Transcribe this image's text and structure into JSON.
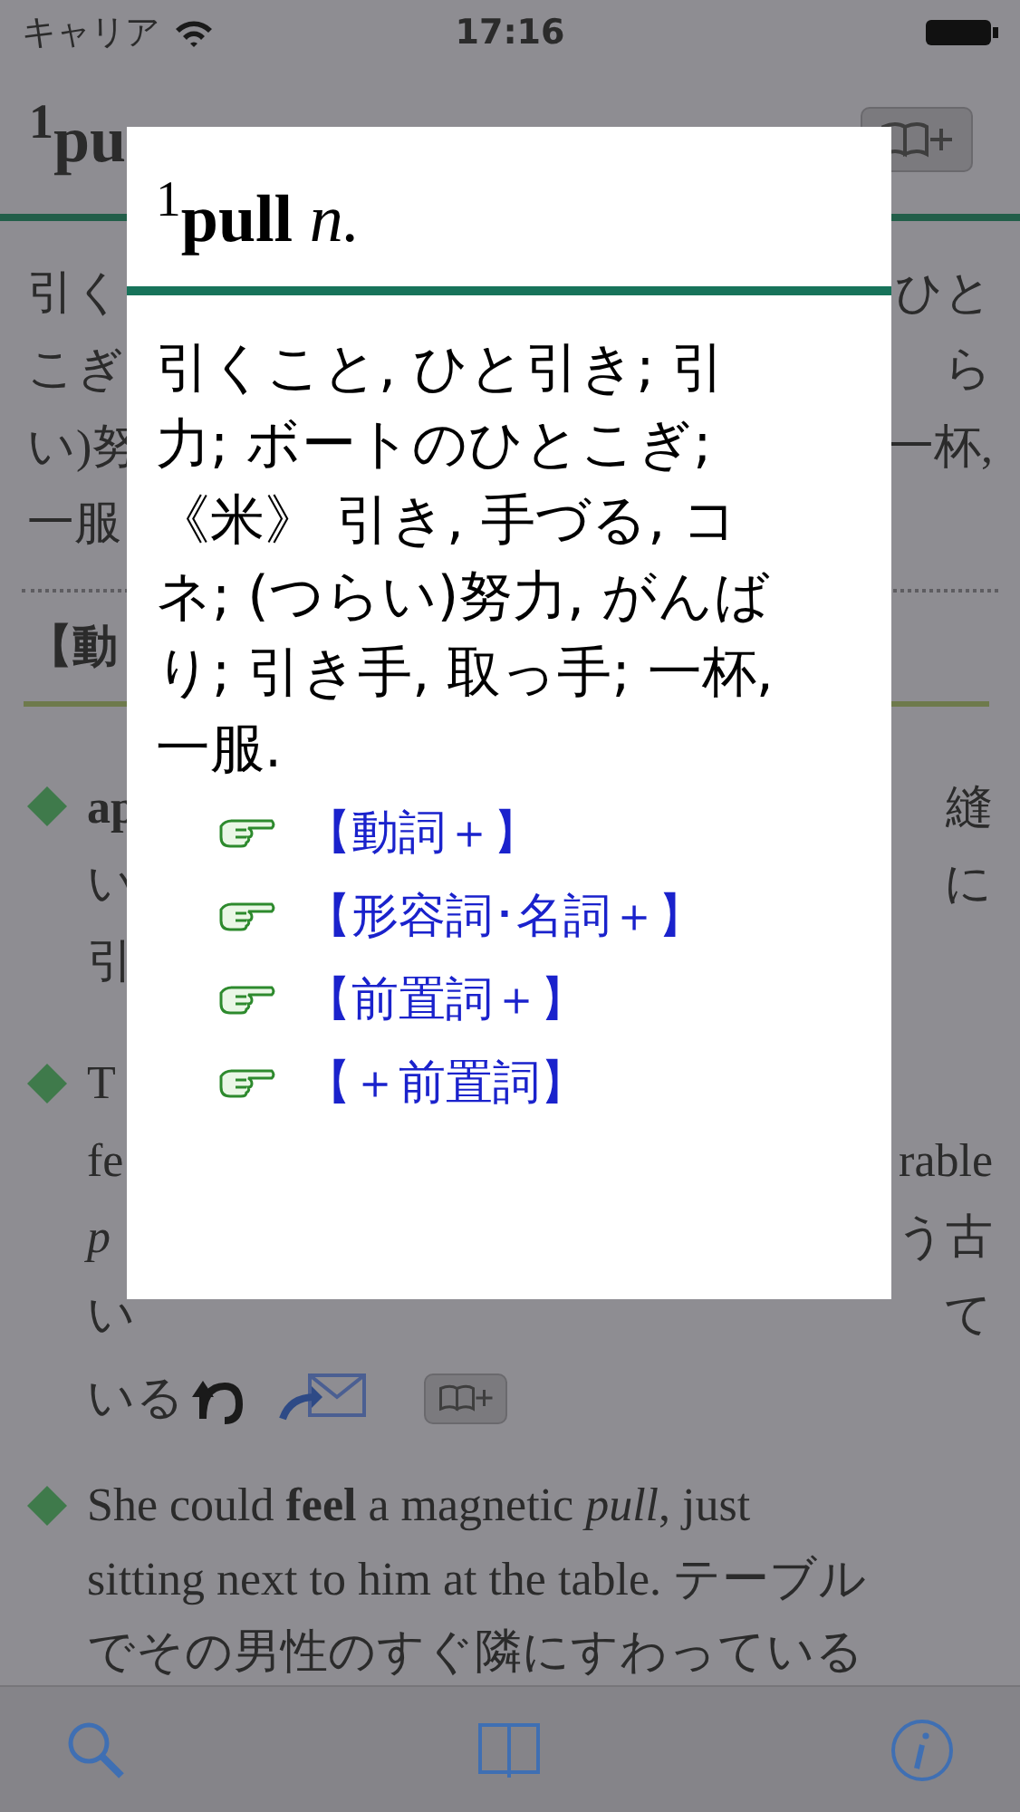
{
  "status_bar": {
    "carrier": "キャリア",
    "time": "17:16"
  },
  "entry": {
    "headword": "$^{1}$pu",
    "definition_lines": [
      {
        "left": "引く",
        "right": "ひと"
      },
      {
        "left": "こぎ",
        "right": "ら"
      },
      {
        "left": "い)努",
        "right": "一杯,"
      },
      {
        "left": "一服"
      }
    ],
    "section_heading": "【動",
    "examples": [
      {
        "lines": [
          {
            "kind": "text",
            "left": "**ap**",
            "right": "縫"
          },
          {
            "kind": "text",
            "left": "い",
            "right": "に"
          },
          {
            "kind": "text",
            "left": "引"
          }
        ]
      },
      {
        "lines": [
          {
            "kind": "text",
            "left": "T"
          },
          {
            "kind": "text",
            "left": "fe",
            "right": "rable"
          },
          {
            "kind": "text",
            "left": "*p*",
            "right": "う古"
          },
          {
            "kind": "text",
            "left": "い",
            "right": "て"
          },
          {
            "kind": "actions",
            "left": "いる"
          }
        ]
      },
      {
        "lines": [
          {
            "kind": "text",
            "left": "She could **feel** a magnetic *pull*, just"
          },
          {
            "kind": "text",
            "left": "sitting next to him at the table. テーブル"
          },
          {
            "kind": "text",
            "left": "でその男性のすぐ隣にすわっている"
          }
        ]
      }
    ]
  },
  "popup": {
    "headword": "$^{1}$**pull** *n.*",
    "definition": "引くこと, ひと引き; 引力; ボートのひとこぎ; 《米》 引き, 手づる, コネ; (つらい)努力, がんばり; 引き手, 取っ手; 一杯, 一服.",
    "links": [
      "【動詞＋】",
      "【形容詞･名詞＋】",
      "【前置詞＋】",
      "【＋前置詞】"
    ]
  }
}
